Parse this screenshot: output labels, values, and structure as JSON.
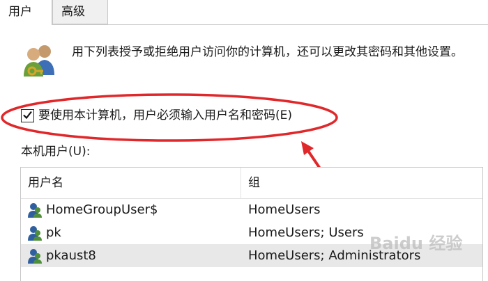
{
  "tabs": [
    {
      "label": "用户"
    },
    {
      "label": "高级"
    }
  ],
  "description": "用下列表授予或拒绝用户访问你的计算机，还可以更改其密码和其他设置。",
  "checkbox": {
    "label": "要使用本计算机，用户必须输入用户名和密码(E)",
    "checked": true
  },
  "users_section_label": "本机用户(U):",
  "table": {
    "columns": [
      "用户名",
      "组"
    ],
    "rows": [
      {
        "name": "HomeGroupUser$",
        "group": "HomeUsers"
      },
      {
        "name": "pk",
        "group": "HomeUsers; Users"
      },
      {
        "name": "pkaust8",
        "group": "HomeUsers; Administrators"
      }
    ]
  },
  "icons": {
    "users": "users-key-icon",
    "user_row": "user-icon"
  },
  "colors": {
    "annotation": "#e0282b",
    "selected_row": "#e8e8e8",
    "border": "#c8c8c8"
  },
  "watermark": "Baidu 经验"
}
